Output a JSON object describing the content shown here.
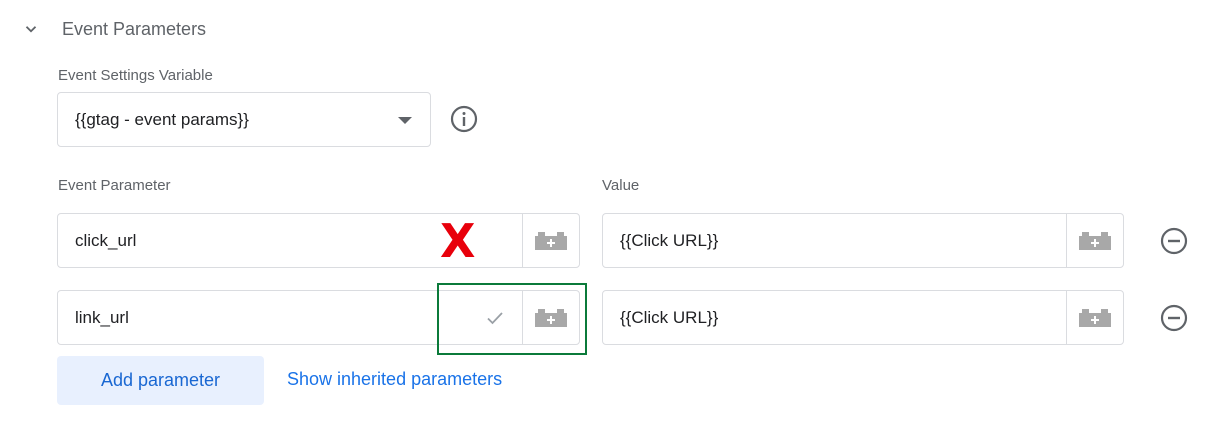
{
  "section": {
    "title": "Event Parameters",
    "icon": "chevron-down-icon"
  },
  "settings_variable": {
    "label": "Event Settings Variable",
    "value": "{{gtag - event params}}",
    "info_icon": "info-icon"
  },
  "columns": {
    "parameter": "Event Parameter",
    "value": "Value"
  },
  "rows": [
    {
      "parameter": "click_url",
      "value": "{{Click URL}}",
      "annotation": "X"
    },
    {
      "parameter": "link_url",
      "value": "{{Click URL}}"
    }
  ],
  "buttons": {
    "add": "Add parameter",
    "show_inherited": "Show inherited parameters"
  },
  "colors": {
    "accent": "#1a73e8",
    "annotation_red": "#e8000b",
    "annotation_green": "#0b7a3a"
  }
}
